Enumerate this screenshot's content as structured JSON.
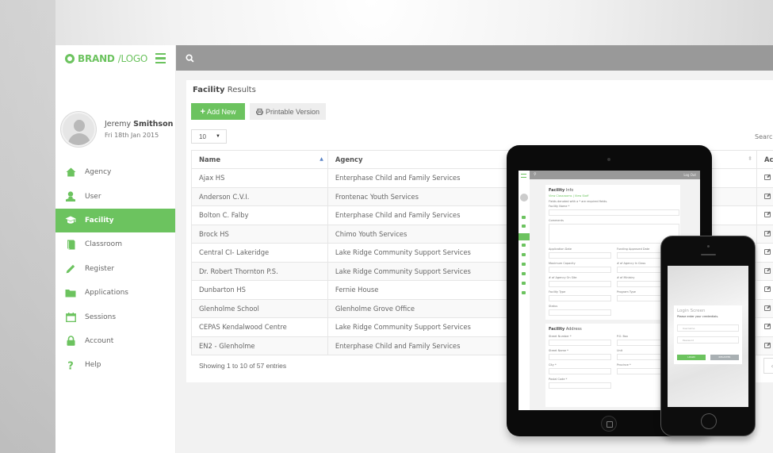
{
  "brand": {
    "bold": "BRAND",
    "light": "/LOGO"
  },
  "profile": {
    "first_name": "Jeremy",
    "last_name": "Smithson",
    "date": "Fri 18th Jan 2015"
  },
  "sidebar": {
    "items": [
      {
        "label": "Agency",
        "icon": "home-icon",
        "glyph": "⌂"
      },
      {
        "label": "User",
        "icon": "user-icon",
        "glyph": "👤"
      },
      {
        "label": "Facility",
        "icon": "graduation-cap-icon",
        "glyph": "🎓",
        "active": true
      },
      {
        "label": "Classroom",
        "icon": "book-icon",
        "glyph": "▮"
      },
      {
        "label": "Register",
        "icon": "pencil-icon",
        "glyph": "✎"
      },
      {
        "label": "Applications",
        "icon": "folder-icon",
        "glyph": "▬"
      },
      {
        "label": "Sessions",
        "icon": "calendar-icon",
        "glyph": "▣"
      },
      {
        "label": "Account",
        "icon": "lock-icon",
        "glyph": "🔒"
      },
      {
        "label": "Help",
        "icon": "question-icon",
        "glyph": "?"
      }
    ]
  },
  "topbar": {
    "search_icon": "search-icon"
  },
  "panel": {
    "title_bold": "Facility",
    "title_light": "Results",
    "add_button": "Add New",
    "print_button": "Printable Version",
    "page_length": "10",
    "search_label": "Search",
    "columns": [
      "Name",
      "Agency",
      "Ac"
    ],
    "rows": [
      {
        "name": "Ajax HS",
        "agency": "Enterphase Child and Family Services"
      },
      {
        "name": "Anderson C.V.I.",
        "agency": "Frontenac Youth Services"
      },
      {
        "name": "Bolton C. Falby",
        "agency": "Enterphase Child and Family Services"
      },
      {
        "name": "Brock HS",
        "agency": "Chimo Youth Services"
      },
      {
        "name": "Central CI- Lakeridge",
        "agency": "Lake Ridge Community Support Services"
      },
      {
        "name": "Dr. Robert Thornton P.S.",
        "agency": "Lake Ridge Community Support Services"
      },
      {
        "name": "Dunbarton HS",
        "agency": "Fernie House"
      },
      {
        "name": "Glenholme School",
        "agency": "Glenholme Grove Office"
      },
      {
        "name": "CEPAS Kendalwood Centre",
        "agency": "Lake Ridge Community Support Services"
      },
      {
        "name": "EN2 - Glenholme",
        "agency": "Enterphase Child and Family Services"
      }
    ],
    "info": "Showing 1 to 10 of 57 entries",
    "prev": "‹"
  },
  "tablet": {
    "logout": "Log Out",
    "title_bold": "Facility",
    "title_light": "Info",
    "links": "View Classrooms | View Staff",
    "required_note": "Fields denoted with a * are required fields.",
    "fields": {
      "facility_name": "Facility Name *",
      "comments": "Comments",
      "application_date": "Application Date",
      "funding_approved_date": "Funding Approved Date",
      "maximum_capacity": "Maximum Capacity",
      "agency_in_class": "# of Agency In Class",
      "agency_on_site": "# of Agency On Site",
      "ministry": "# of Ministry",
      "facility_type": "Facility Type",
      "program_type": "Program Type",
      "status": "Status"
    },
    "address_bold": "Facility",
    "address_light": "Address",
    "address_fields": {
      "street_number": "Street Number *",
      "po_box": "P.O. Box",
      "street_name": "Street Name *",
      "unit": "Unit",
      "city": "City *",
      "province": "Province *",
      "postal_code": "Postal Code *"
    }
  },
  "phone": {
    "title": "Login Screen",
    "subtitle": "Please enter your credentials.",
    "username_placeholder": "Username",
    "password_placeholder": "Password",
    "login_button": "LOGIN",
    "register_button": "REGISTER"
  },
  "colors": {
    "accent": "#6cc35f",
    "topbar": "#999999",
    "background": "#f2f2f2"
  }
}
